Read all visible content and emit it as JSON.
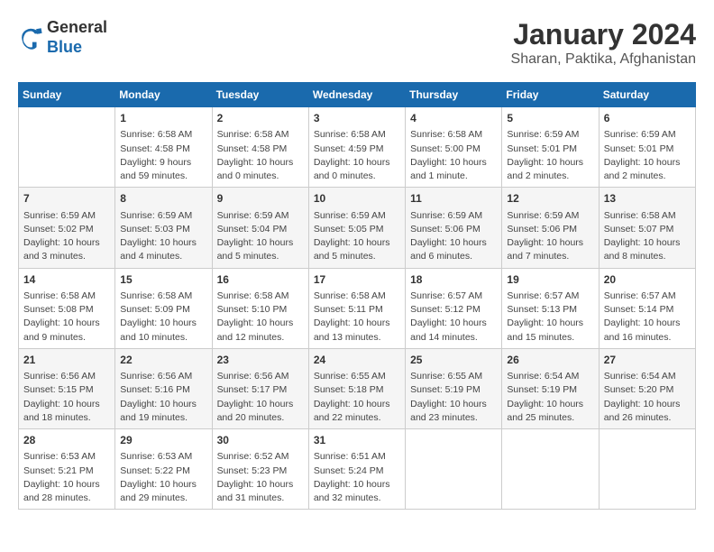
{
  "header": {
    "logo_general": "General",
    "logo_blue": "Blue",
    "month_year": "January 2024",
    "location": "Sharan, Paktika, Afghanistan"
  },
  "days_of_week": [
    "Sunday",
    "Monday",
    "Tuesday",
    "Wednesday",
    "Thursday",
    "Friday",
    "Saturday"
  ],
  "weeks": [
    [
      {
        "day": "",
        "info": ""
      },
      {
        "day": "1",
        "info": "Sunrise: 6:58 AM\nSunset: 4:58 PM\nDaylight: 9 hours\nand 59 minutes."
      },
      {
        "day": "2",
        "info": "Sunrise: 6:58 AM\nSunset: 4:58 PM\nDaylight: 10 hours\nand 0 minutes."
      },
      {
        "day": "3",
        "info": "Sunrise: 6:58 AM\nSunset: 4:59 PM\nDaylight: 10 hours\nand 0 minutes."
      },
      {
        "day": "4",
        "info": "Sunrise: 6:58 AM\nSunset: 5:00 PM\nDaylight: 10 hours\nand 1 minute."
      },
      {
        "day": "5",
        "info": "Sunrise: 6:59 AM\nSunset: 5:01 PM\nDaylight: 10 hours\nand 2 minutes."
      },
      {
        "day": "6",
        "info": "Sunrise: 6:59 AM\nSunset: 5:01 PM\nDaylight: 10 hours\nand 2 minutes."
      }
    ],
    [
      {
        "day": "7",
        "info": "Sunrise: 6:59 AM\nSunset: 5:02 PM\nDaylight: 10 hours\nand 3 minutes."
      },
      {
        "day": "8",
        "info": "Sunrise: 6:59 AM\nSunset: 5:03 PM\nDaylight: 10 hours\nand 4 minutes."
      },
      {
        "day": "9",
        "info": "Sunrise: 6:59 AM\nSunset: 5:04 PM\nDaylight: 10 hours\nand 5 minutes."
      },
      {
        "day": "10",
        "info": "Sunrise: 6:59 AM\nSunset: 5:05 PM\nDaylight: 10 hours\nand 5 minutes."
      },
      {
        "day": "11",
        "info": "Sunrise: 6:59 AM\nSunset: 5:06 PM\nDaylight: 10 hours\nand 6 minutes."
      },
      {
        "day": "12",
        "info": "Sunrise: 6:59 AM\nSunset: 5:06 PM\nDaylight: 10 hours\nand 7 minutes."
      },
      {
        "day": "13",
        "info": "Sunrise: 6:58 AM\nSunset: 5:07 PM\nDaylight: 10 hours\nand 8 minutes."
      }
    ],
    [
      {
        "day": "14",
        "info": "Sunrise: 6:58 AM\nSunset: 5:08 PM\nDaylight: 10 hours\nand 9 minutes."
      },
      {
        "day": "15",
        "info": "Sunrise: 6:58 AM\nSunset: 5:09 PM\nDaylight: 10 hours\nand 10 minutes."
      },
      {
        "day": "16",
        "info": "Sunrise: 6:58 AM\nSunset: 5:10 PM\nDaylight: 10 hours\nand 12 minutes."
      },
      {
        "day": "17",
        "info": "Sunrise: 6:58 AM\nSunset: 5:11 PM\nDaylight: 10 hours\nand 13 minutes."
      },
      {
        "day": "18",
        "info": "Sunrise: 6:57 AM\nSunset: 5:12 PM\nDaylight: 10 hours\nand 14 minutes."
      },
      {
        "day": "19",
        "info": "Sunrise: 6:57 AM\nSunset: 5:13 PM\nDaylight: 10 hours\nand 15 minutes."
      },
      {
        "day": "20",
        "info": "Sunrise: 6:57 AM\nSunset: 5:14 PM\nDaylight: 10 hours\nand 16 minutes."
      }
    ],
    [
      {
        "day": "21",
        "info": "Sunrise: 6:56 AM\nSunset: 5:15 PM\nDaylight: 10 hours\nand 18 minutes."
      },
      {
        "day": "22",
        "info": "Sunrise: 6:56 AM\nSunset: 5:16 PM\nDaylight: 10 hours\nand 19 minutes."
      },
      {
        "day": "23",
        "info": "Sunrise: 6:56 AM\nSunset: 5:17 PM\nDaylight: 10 hours\nand 20 minutes."
      },
      {
        "day": "24",
        "info": "Sunrise: 6:55 AM\nSunset: 5:18 PM\nDaylight: 10 hours\nand 22 minutes."
      },
      {
        "day": "25",
        "info": "Sunrise: 6:55 AM\nSunset: 5:19 PM\nDaylight: 10 hours\nand 23 minutes."
      },
      {
        "day": "26",
        "info": "Sunrise: 6:54 AM\nSunset: 5:19 PM\nDaylight: 10 hours\nand 25 minutes."
      },
      {
        "day": "27",
        "info": "Sunrise: 6:54 AM\nSunset: 5:20 PM\nDaylight: 10 hours\nand 26 minutes."
      }
    ],
    [
      {
        "day": "28",
        "info": "Sunrise: 6:53 AM\nSunset: 5:21 PM\nDaylight: 10 hours\nand 28 minutes."
      },
      {
        "day": "29",
        "info": "Sunrise: 6:53 AM\nSunset: 5:22 PM\nDaylight: 10 hours\nand 29 minutes."
      },
      {
        "day": "30",
        "info": "Sunrise: 6:52 AM\nSunset: 5:23 PM\nDaylight: 10 hours\nand 31 minutes."
      },
      {
        "day": "31",
        "info": "Sunrise: 6:51 AM\nSunset: 5:24 PM\nDaylight: 10 hours\nand 32 minutes."
      },
      {
        "day": "",
        "info": ""
      },
      {
        "day": "",
        "info": ""
      },
      {
        "day": "",
        "info": ""
      }
    ]
  ]
}
